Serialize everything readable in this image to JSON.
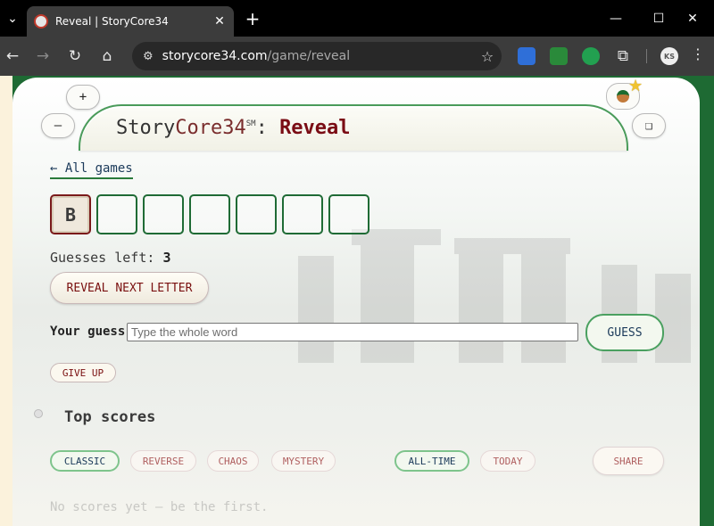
{
  "browser": {
    "tab_title": "Reveal | StoryCore34",
    "tab_close": "✕",
    "new_tab": "+",
    "url_host": "storycore34.com",
    "url_path": "/game/reveal",
    "tab_menu_glyph": "⌄",
    "back_glyph": "←",
    "forward_glyph": "→",
    "reload_glyph": "↻",
    "home_glyph": "⌂",
    "tune_glyph": "⚙",
    "star_glyph": "☆",
    "minimize_glyph": "—",
    "maximize_glyph": "☐",
    "close_glyph": "✕",
    "profile_initials": "KS",
    "kebab_glyph": "⋮",
    "extension_colors": [
      "#2f6fd8",
      "#2a8a3a",
      "#22a050"
    ],
    "puzzle_glyph": "⧉"
  },
  "header": {
    "zoom_in_label": "+",
    "zoom_out_label": "–",
    "fullscreen_label": "❏",
    "title_story": "Story",
    "title_core": "Core34",
    "title_sm": "SM",
    "title_colon": ":",
    "title_mode": "Reveal",
    "badge_glyph": "★"
  },
  "nav": {
    "back_label": "← All games"
  },
  "game": {
    "tiles": [
      "B",
      "",
      "",
      "",
      "",
      "",
      ""
    ],
    "guesses_left_label": "Guesses left:",
    "guesses_left_value": "3",
    "reveal_button": "REVEAL NEXT LETTER",
    "your_guess_label": "Your guess",
    "guess_placeholder": "Type the whole word",
    "guess_button": "GUESS",
    "give_up_button": "GIVE UP"
  },
  "scores": {
    "title": "Top scores",
    "modes": [
      "CLASSIC",
      "REVERSE",
      "CHAOS",
      "MYSTERY"
    ],
    "periods": [
      "ALL-TIME",
      "TODAY"
    ],
    "share_button": "SHARE",
    "empty_text": "No scores yet — be the first."
  },
  "colors": {
    "accent_green": "#1f6b35",
    "accent_red": "#7a0c14"
  }
}
